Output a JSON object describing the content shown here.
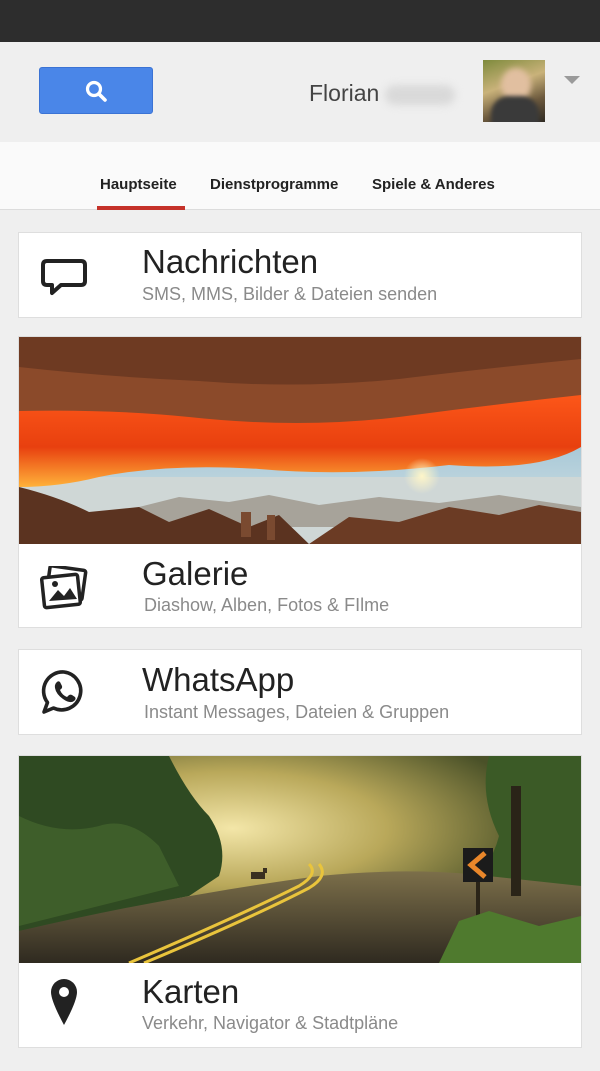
{
  "header": {
    "user_first_name": "Florian"
  },
  "tabs": [
    {
      "label": "Hauptseite",
      "active": true
    },
    {
      "label": "Dienstprogramme",
      "active": false
    },
    {
      "label": "Spiele & Anderes",
      "active": false
    }
  ],
  "cards": [
    {
      "title": "Nachrichten",
      "subtitle": "SMS, MMS, Bilder & Dateien senden",
      "icon": "chat-bubble-icon",
      "image": null
    },
    {
      "title": "Galerie",
      "subtitle": "Diashow, Alben, Fotos & FIlme",
      "icon": "photos-icon",
      "image": "desert-arch-photo"
    },
    {
      "title": "WhatsApp",
      "subtitle": "Instant Messages, Dateien & Gruppen",
      "icon": "whatsapp-icon",
      "image": null
    },
    {
      "title": "Karten",
      "subtitle": "Verkehr, Navigator & Stadtpläne",
      "icon": "map-pin-icon",
      "image": "forest-road-photo"
    }
  ],
  "colors": {
    "accent_blue": "#4a86e8",
    "tab_underline": "#c5322a",
    "status_bar": "#2d2d2d"
  }
}
